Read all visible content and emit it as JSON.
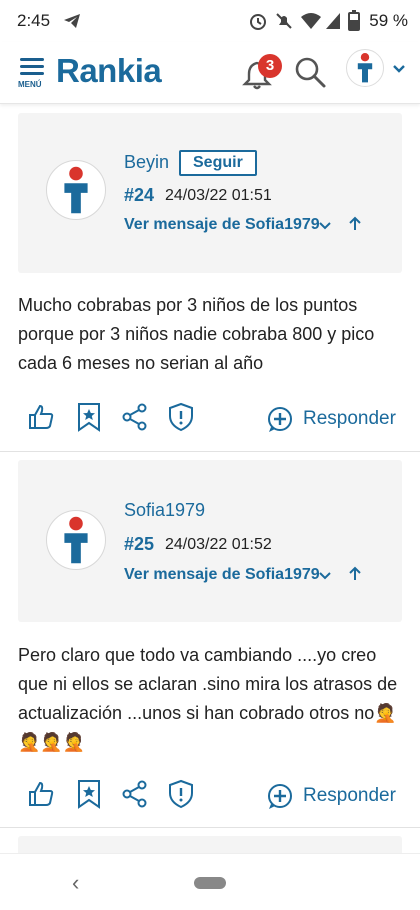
{
  "status_bar": {
    "time": "2:45",
    "battery": "59 %"
  },
  "header": {
    "menu_label": "MENÚ",
    "logo": "Rankia",
    "notification_count": "3"
  },
  "posts": [
    {
      "username": "Beyin",
      "follow_label": "Seguir",
      "post_number": "#24",
      "date": "24/03/22 01:51",
      "reply_ref": "Ver mensaje de Sofia1979",
      "message": "Mucho cobrabas por 3 niños de los puntos porque por 3 niños nadie cobraba 800 y pico cada 6 meses no serian al año",
      "respond_label": "Responder"
    },
    {
      "username": "Sofia1979",
      "post_number": "#25",
      "date": "24/03/22 01:52",
      "reply_ref": "Ver mensaje de Sofia1979",
      "message": "Pero claro que todo va cambiando ....yo creo que ni ellos se aclaran .sino mira los atrasos de actualización ...unos si  han cobrado otros no🤦🤦🤦🤦",
      "respond_label": "Responder"
    }
  ],
  "colors": {
    "brand": "#1b6a9c",
    "badge": "#d9352d",
    "avatar_head": "#d9352d"
  }
}
